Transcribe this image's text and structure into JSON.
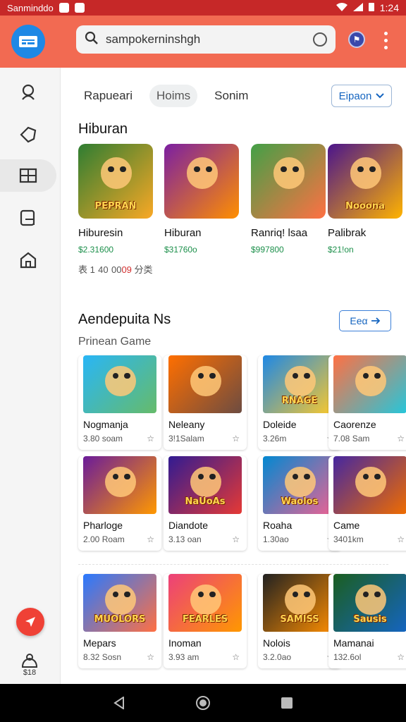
{
  "status_bar": {
    "carrier": "Sanminddo",
    "time": "1:24"
  },
  "search": {
    "value": "sampokerninshgh"
  },
  "appbar": {
    "badge": "⚑"
  },
  "tabs": [
    {
      "label": "Rapueari",
      "active": false
    },
    {
      "label": "Hoims",
      "active": true
    },
    {
      "label": "Sonim",
      "active": false
    }
  ],
  "tab_dropdown": {
    "label": "Eipaon"
  },
  "featured": {
    "title": "Hiburan",
    "items": [
      {
        "name": "Hiburesin",
        "price": "$2.31600",
        "thumb_text": "PEPRAN",
        "colors": [
          "#2e7d32",
          "#f9a825"
        ]
      },
      {
        "name": "Hiburan",
        "price": "$31760o",
        "thumb_text": "",
        "colors": [
          "#7b1fa2",
          "#ff8f00"
        ]
      },
      {
        "name": "Ranriq! lsaa",
        "price": "$997800",
        "thumb_text": "",
        "colors": [
          "#43a047",
          "#ff7043"
        ]
      },
      {
        "name": "Palibrak",
        "price": "$21!on",
        "thumb_text": "Nooona",
        "colors": [
          "#4a148c",
          "#ffb300"
        ]
      }
    ],
    "meta": {
      "prefix": "表 1 40 00",
      "highlight": "09",
      "suffix": " 分类"
    }
  },
  "section2": {
    "title": "Aendepuita Ns",
    "subtitle": "Prinean Game",
    "see_all": "Eeα",
    "rows": [
      [
        {
          "name": "Nogmanja",
          "meta": "3.80 soam",
          "thumb_text": "",
          "colors": [
            "#29b6f6",
            "#66bb6a"
          ]
        },
        {
          "name": "Neleany",
          "meta": "3!1Salam",
          "thumb_text": "",
          "colors": [
            "#ff6f00",
            "#6d4c41"
          ]
        },
        {
          "name": "Doleide",
          "meta": "3.26m",
          "thumb_text": "RNAGE",
          "colors": [
            "#1e88e5",
            "#ffca28"
          ]
        },
        {
          "name": "Caorenze",
          "meta": "7.08 Sam",
          "thumb_text": "",
          "colors": [
            "#ff7043",
            "#26c6da"
          ]
        }
      ],
      [
        {
          "name": "Pharloge",
          "meta": "2.00 Roam",
          "thumb_text": "",
          "colors": [
            "#6a1b9a",
            "#ff9800"
          ]
        },
        {
          "name": "Diandote",
          "meta": "3.13 oan",
          "thumb_text": "NaUoAs",
          "colors": [
            "#311b92",
            "#e53935"
          ]
        },
        {
          "name": "Roaha",
          "meta": "1.30ao",
          "thumb_text": "Waolos",
          "colors": [
            "#0288d1",
            "#f06292"
          ]
        },
        {
          "name": "Came",
          "meta": "3401km",
          "thumb_text": "",
          "colors": [
            "#4527a0",
            "#ef6c00"
          ]
        }
      ],
      [
        {
          "name": "Mepars",
          "meta": "8.32 Sosn",
          "thumb_text": "MUOLORS",
          "colors": [
            "#2979ff",
            "#ff7043"
          ]
        },
        {
          "name": "Inoman",
          "meta": "3.93 am",
          "thumb_text": "FEARLES",
          "colors": [
            "#ec407a",
            "#ff9800"
          ]
        },
        {
          "name": "Nolois",
          "meta": "3.2.0ao",
          "thumb_text": "SAMISS",
          "colors": [
            "#212121",
            "#ff8f00"
          ]
        },
        {
          "name": "Mamanai",
          "meta": "132.6ol",
          "thumb_text": "Sausis",
          "colors": [
            "#1b5e20",
            "#1565c0"
          ]
        }
      ]
    ]
  },
  "rail": {
    "bottom_label": "$18"
  },
  "colors": {
    "app_bar": "#f26a52",
    "status_bar": "#c62828",
    "accent": "#1565c0",
    "price": "#1b8f4a"
  }
}
